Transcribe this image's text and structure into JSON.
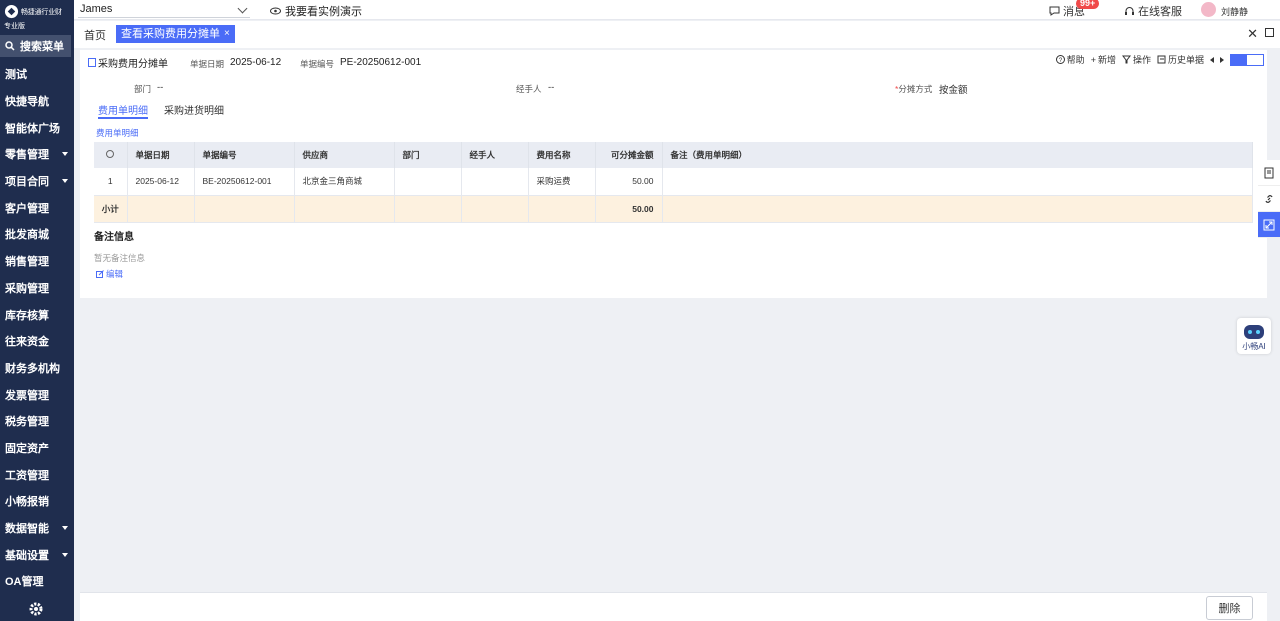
{
  "brand": {
    "name": "畅捷通行业财",
    "edition": "专业版"
  },
  "sidebar": {
    "search_label": "搜索菜单",
    "items": [
      {
        "label": "测试",
        "has_children": false
      },
      {
        "label": "快捷导航",
        "has_children": false
      },
      {
        "label": "智能体广场",
        "has_children": false
      },
      {
        "label": "零售管理",
        "has_children": true
      },
      {
        "label": "项目合同",
        "has_children": true
      },
      {
        "label": "客户管理",
        "has_children": false
      },
      {
        "label": "批发商城",
        "has_children": false
      },
      {
        "label": "销售管理",
        "has_children": false
      },
      {
        "label": "采购管理",
        "has_children": false
      },
      {
        "label": "库存核算",
        "has_children": false
      },
      {
        "label": "往来资金",
        "has_children": false
      },
      {
        "label": "财务多机构",
        "has_children": false
      },
      {
        "label": "发票管理",
        "has_children": false
      },
      {
        "label": "税务管理",
        "has_children": false
      },
      {
        "label": "固定资产",
        "has_children": false
      },
      {
        "label": "工资管理",
        "has_children": false
      },
      {
        "label": "小畅报销",
        "has_children": false
      },
      {
        "label": "数据智能",
        "has_children": true
      },
      {
        "label": "基础设置",
        "has_children": true
      },
      {
        "label": "OA管理",
        "has_children": false
      }
    ]
  },
  "topbar": {
    "user_select": "James",
    "demo_label": "我要看实例演示",
    "messages_label": "消息",
    "messages_badge": "99+",
    "service_label": "在线客服",
    "username": "刘静静"
  },
  "tabs": {
    "home": "首页",
    "active": "查看采购费用分摊单",
    "close": "×"
  },
  "document": {
    "title": "采购费用分摊单",
    "date_label": "单据日期",
    "date_value": "2025-06-12",
    "number_label": "单据编号",
    "number_value": "PE-20250612-001",
    "actions": {
      "help": "帮助",
      "new": "新增",
      "operate": "操作",
      "history": "历史单据"
    },
    "fields": {
      "department_label": "部门",
      "department_value": "--",
      "handler_label": "经手人",
      "handler_value": "--",
      "alloc_label": "分摊方式",
      "alloc_value": "按金额"
    },
    "subtabs": {
      "expense_detail": "费用单明细",
      "purchase_detail": "采购进货明细"
    },
    "section_link": "费用单明细"
  },
  "table": {
    "headers": [
      "单据日期",
      "单据编号",
      "供应商",
      "部门",
      "经手人",
      "费用名称",
      "可分摊金额",
      "备注（费用单明细）"
    ],
    "rows": [
      {
        "index": "1",
        "date": "2025-06-12",
        "number": "BE-20250612-001",
        "supplier": "北京金三角商城",
        "dept": "",
        "handler": "",
        "expense": "采购运费",
        "amount": "50.00",
        "note": ""
      }
    ],
    "subtotal_label": "小计",
    "subtotal_amount": "50.00"
  },
  "notes": {
    "title": "备注信息",
    "empty": "暂无备注信息",
    "edit": "编辑"
  },
  "ai": {
    "label": "小畅AI"
  },
  "footer": {
    "delete_label": "删除"
  },
  "colors": {
    "sidebar": "#1f2d4e",
    "accent": "#4a6cf7",
    "subtotal_bg": "#fdf1df",
    "badge": "#f04a4a"
  }
}
